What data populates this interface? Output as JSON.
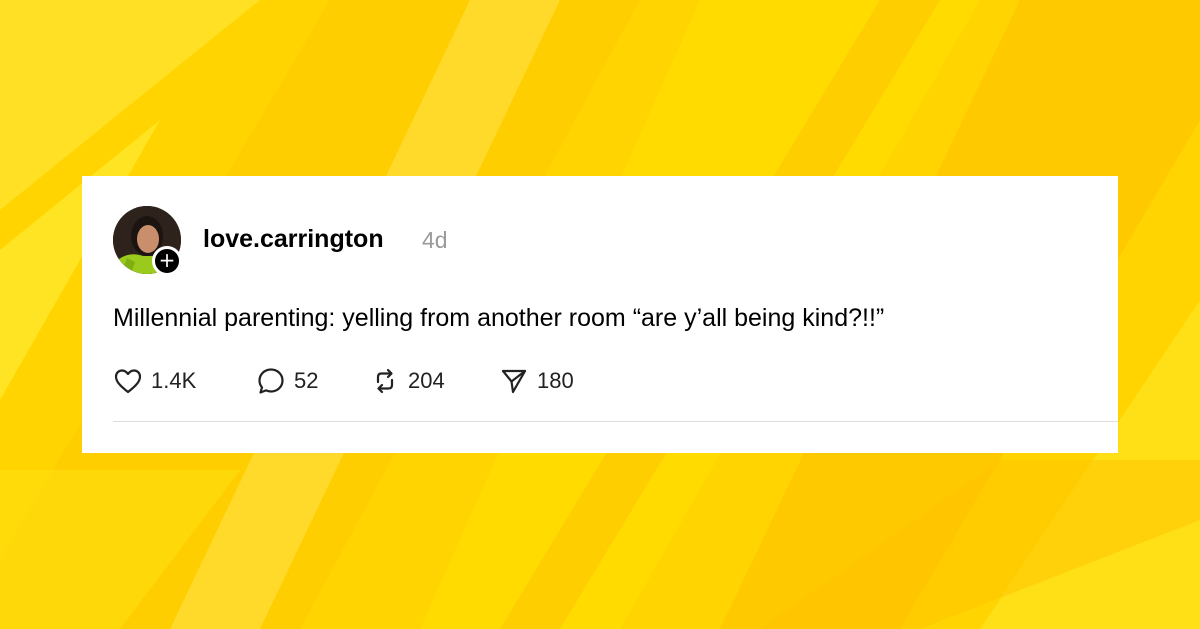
{
  "colors": {
    "background": "#ffd400",
    "card": "#ffffff",
    "username": "#000000",
    "timestamp": "#9a9a9a",
    "badge": "#000000"
  },
  "post": {
    "username": "love.carrington",
    "timestamp": "4d",
    "text": "Millennial parenting: yelling from another room “are y’all being kind?!!”",
    "avatar_icon": "profile-photo",
    "follow_icon": "plus-icon",
    "follow_glyph": "+"
  },
  "actions": [
    {
      "name": "like",
      "icon": "heart-icon",
      "count": "1.4K"
    },
    {
      "name": "reply",
      "icon": "comment-bubble-icon",
      "count": "52"
    },
    {
      "name": "repost",
      "icon": "repost-icon",
      "count": "204"
    },
    {
      "name": "share",
      "icon": "send-icon",
      "count": "180"
    }
  ]
}
